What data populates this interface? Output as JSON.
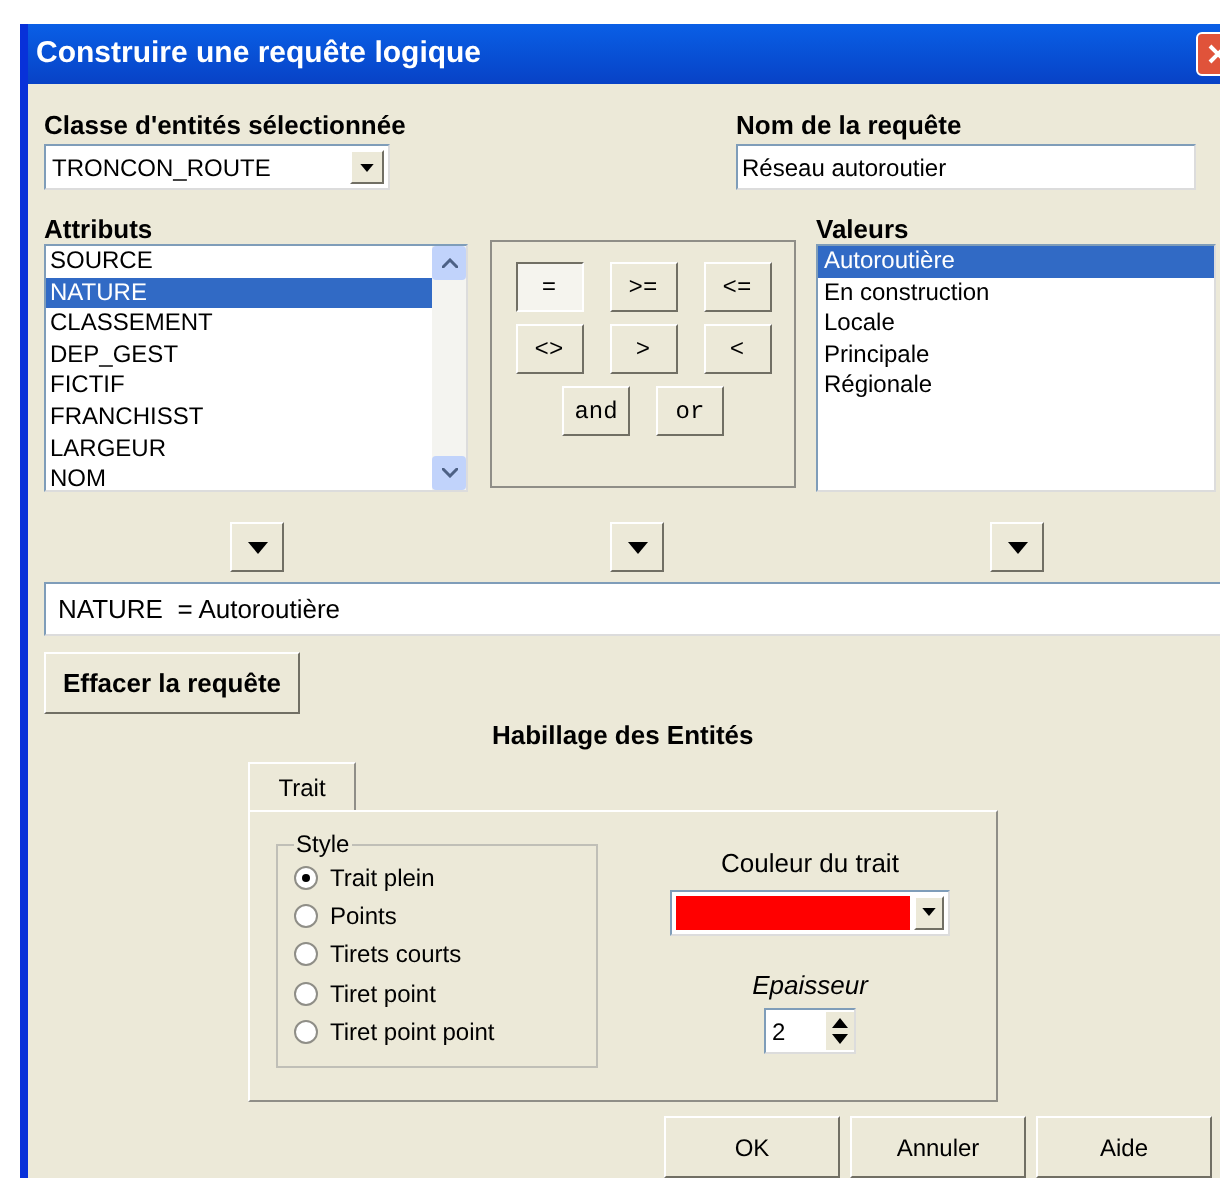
{
  "window": {
    "title": "Construire une requête logique"
  },
  "feature_class": {
    "label": "Classe d'entités sélectionnée",
    "value": "TRONCON_ROUTE"
  },
  "query_name": {
    "label": "Nom de la requête",
    "value": "Réseau autoroutier"
  },
  "attributes": {
    "label": "Attributs",
    "items": [
      {
        "text": "SOURCE",
        "selected": false
      },
      {
        "text": "NATURE",
        "selected": true
      },
      {
        "text": "CLASSEMENT",
        "selected": false
      },
      {
        "text": "DEP_GEST",
        "selected": false
      },
      {
        "text": "FICTIF",
        "selected": false
      },
      {
        "text": "FRANCHISST",
        "selected": false
      },
      {
        "text": "LARGEUR",
        "selected": false
      },
      {
        "text": "NOM",
        "selected": false
      }
    ]
  },
  "operators": [
    {
      "text": "=",
      "selected": true
    },
    {
      "text": ">=",
      "selected": false
    },
    {
      "text": "<=",
      "selected": false
    },
    {
      "text": "<>",
      "selected": false
    },
    {
      "text": ">",
      "selected": false
    },
    {
      "text": "<",
      "selected": false
    },
    {
      "text": "and",
      "selected": false
    },
    {
      "text": "or",
      "selected": false
    }
  ],
  "values": {
    "label": "Valeurs",
    "items": [
      {
        "text": "Autoroutière",
        "selected": true
      },
      {
        "text": "En construction",
        "selected": false
      },
      {
        "text": "Locale",
        "selected": false
      },
      {
        "text": "Principale",
        "selected": false
      },
      {
        "text": "Régionale",
        "selected": false
      }
    ]
  },
  "query": {
    "value": "NATURE  = Autoroutière"
  },
  "clear_button": "Effacer la requête",
  "styling": {
    "title": "Habillage des Entités",
    "tabs": [
      {
        "label": "Trait",
        "selected": true
      }
    ],
    "style_group": {
      "label": "Style",
      "options": [
        {
          "text": "Trait plein",
          "selected": true
        },
        {
          "text": "Points",
          "selected": false
        },
        {
          "text": "Tirets courts",
          "selected": false
        },
        {
          "text": "Tiret point",
          "selected": false
        },
        {
          "text": "Tiret point point",
          "selected": false
        }
      ]
    },
    "line_color": {
      "label": "Couleur du trait",
      "color": "#ff0000"
    },
    "thickness": {
      "label": "Epaisseur",
      "value": "2"
    }
  },
  "buttons": [
    "OK",
    "Annuler",
    "Aide"
  ]
}
